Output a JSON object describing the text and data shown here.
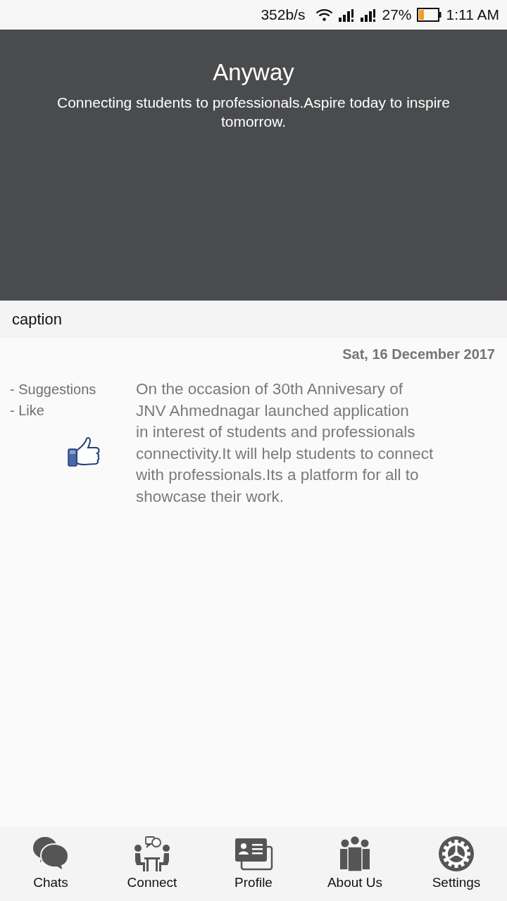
{
  "status_bar": {
    "network_speed": "352b/s",
    "battery": "27%",
    "time": "1:11 AM"
  },
  "header": {
    "title": "Anyway",
    "subtitle": "Connecting students to professionals.Aspire today to inspire tomorrow."
  },
  "caption": "caption",
  "post": {
    "date": "Sat, 16 December 2017",
    "actions": [
      "- Suggestions",
      "- Like"
    ],
    "body": "On the occasion of 30th Annivesary of\nJNV Ahmednagar launched application\nin interest of students and professionals\nconnectivity.It will help students to connect\nwith professionals.Its a platform for all to\nshowcase their work."
  },
  "bottom_nav": [
    {
      "label": "Chats"
    },
    {
      "label": "Connect"
    },
    {
      "label": "Profile"
    },
    {
      "label": "About Us"
    },
    {
      "label": "Settings"
    }
  ]
}
